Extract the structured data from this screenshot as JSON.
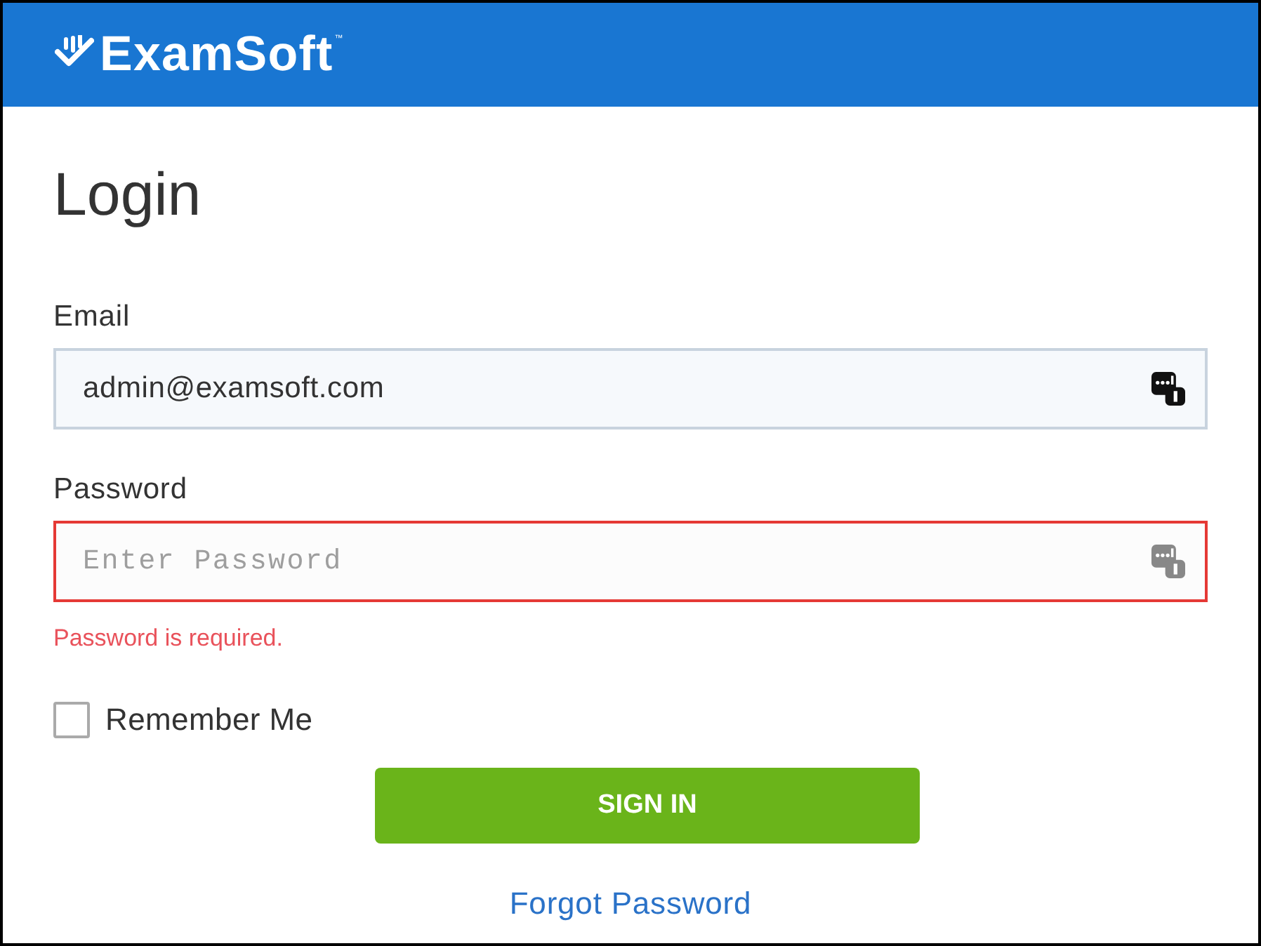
{
  "header": {
    "logo": "ExamSoft",
    "trademark": "™"
  },
  "login": {
    "title": "Login",
    "fields": [
      {
        "label": "Email",
        "value": "admin@examsoft.com",
        "invalid": false
      },
      {
        "label": "Password",
        "placeholder": "Enter Password",
        "invalid": true,
        "error": "Password is required."
      }
    ],
    "remember": {
      "label": "Remember Me",
      "checked": false
    },
    "submit": "SIGN IN",
    "forgot": "Forgot Password"
  }
}
